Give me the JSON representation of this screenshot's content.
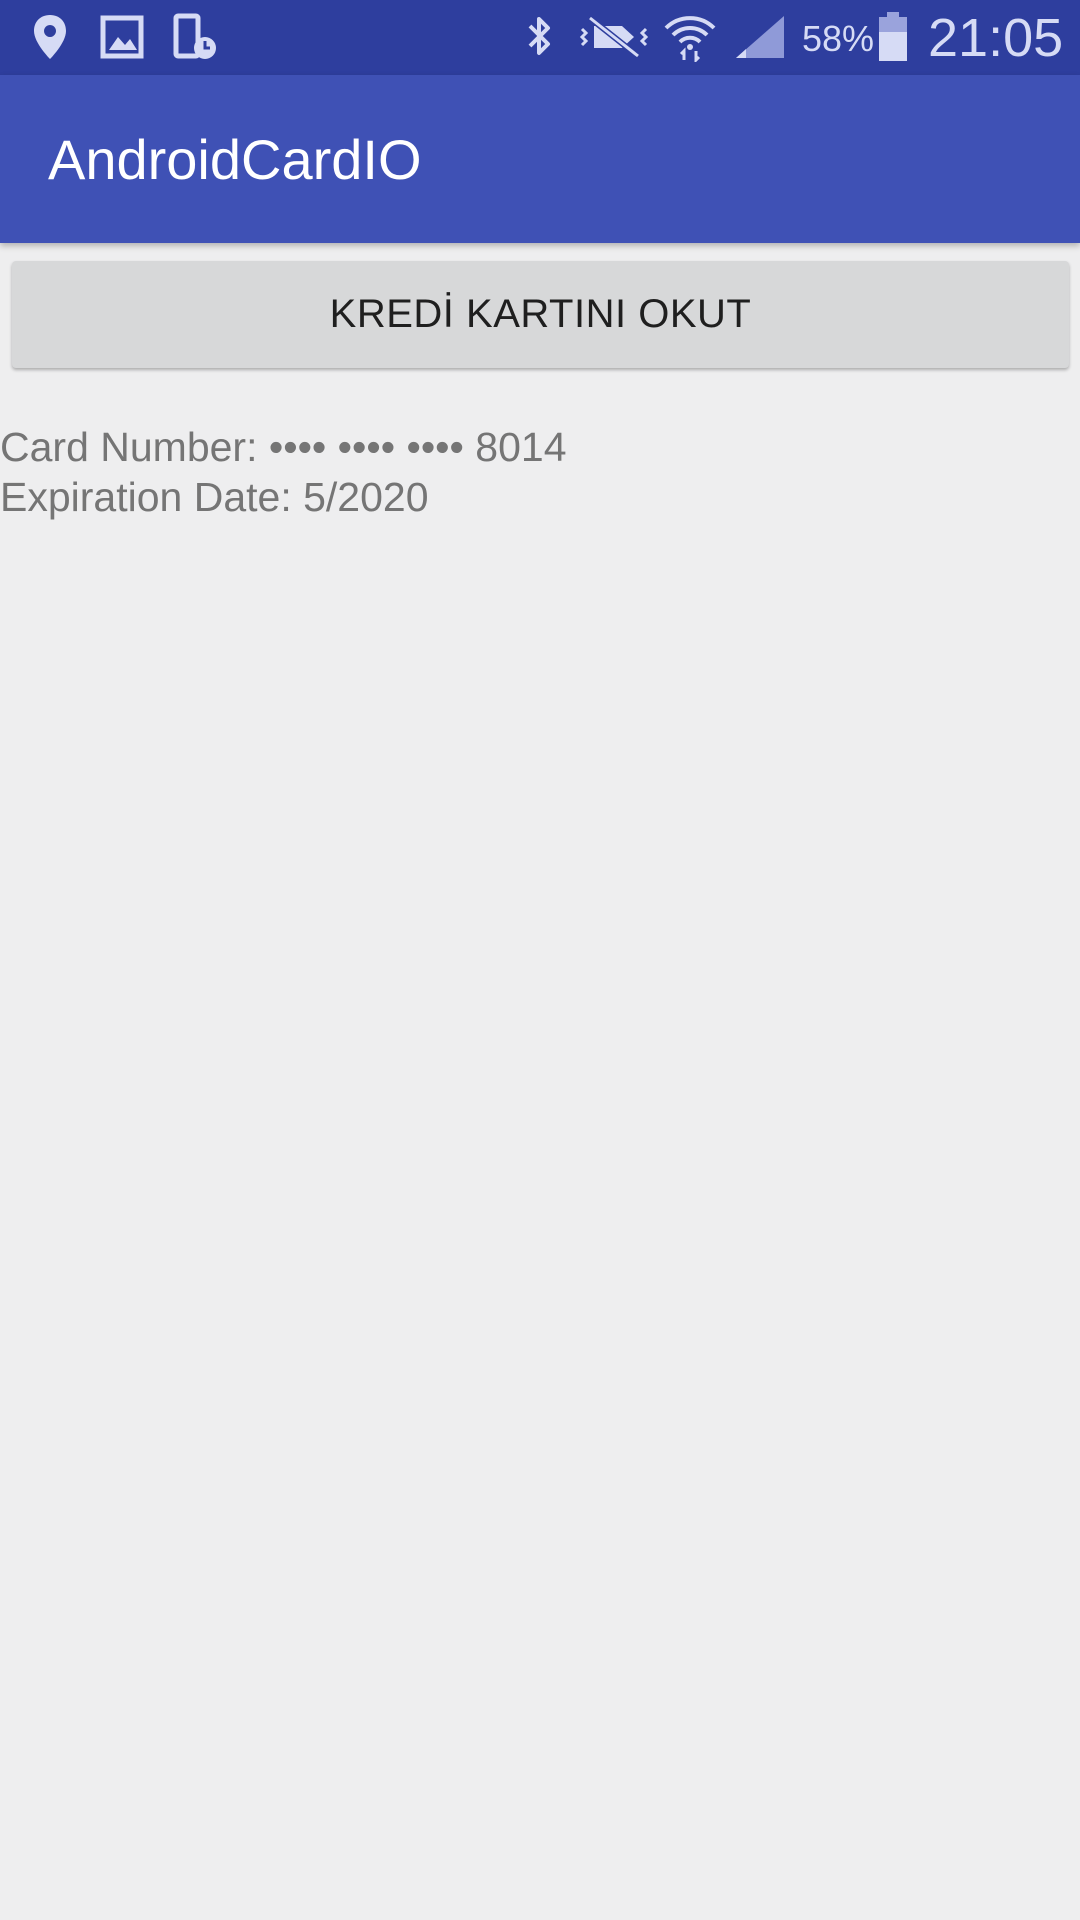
{
  "status_bar": {
    "icons_left": [
      "location-pin-icon",
      "image-icon",
      "device-schedule-icon"
    ],
    "icons_right": [
      "bluetooth-icon",
      "vibrate-mute-icon",
      "wifi-icon",
      "signal-icon",
      "battery-icon"
    ],
    "battery_percent": "58%",
    "time": "21:05",
    "background": "#2e3e9e"
  },
  "app_bar": {
    "title": "AndroidCardIO",
    "background": "#3f51b5"
  },
  "main": {
    "scan_button_label": "KREDİ KARTINI OKUT",
    "card_number_line": "Card Number: •••• •••• •••• 8014",
    "expiration_line": "Expiration Date: 5/2020"
  }
}
